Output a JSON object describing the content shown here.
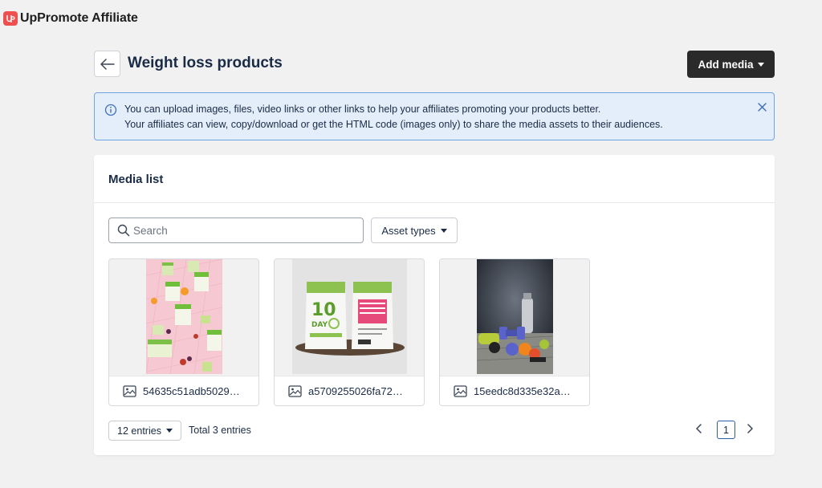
{
  "app": {
    "title": "UpPromote Affiliate",
    "brand_color": "#ef4f4f"
  },
  "page": {
    "title": "Weight loss products",
    "add_media_label": "Add media"
  },
  "banner": {
    "line1": "You can upload images, files, video links or other links to help your affiliates promoting your products better.",
    "line2": "Your affiliates can view, copy/download or get the HTML code (images only) to share the media assets to their audiences."
  },
  "media_list": {
    "title": "Media list",
    "search_placeholder": "Search",
    "filter_label": "Asset types",
    "items": [
      {
        "name": "54635c51adb5029…",
        "icon": "image-icon"
      },
      {
        "name": "a5709255026fa72…",
        "icon": "image-icon"
      },
      {
        "name": "15eedc8d335e32a…",
        "icon": "image-icon"
      }
    ]
  },
  "pagination": {
    "per_page_label": "12 entries",
    "total_label": "Total 3 entries",
    "current_page": "1"
  }
}
